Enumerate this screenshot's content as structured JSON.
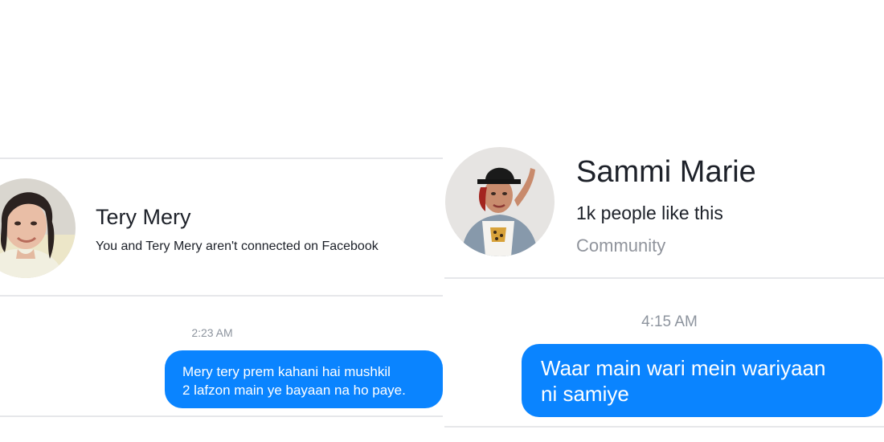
{
  "left_chat": {
    "contact_name": "Tery Mery",
    "connection_status": "You and Tery Mery aren't connected on Facebook",
    "timestamp": "2:23 AM",
    "message": {
      "line1": "Mery tery prem kahani hai mushkil",
      "line2": "2 lafzon main ye bayaan na ho paye."
    }
  },
  "right_chat": {
    "page_name": "Sammi Marie",
    "likes": "1k people like this",
    "category": "Community",
    "timestamp": "4:15 AM",
    "message": {
      "line1": "Waar main wari mein wariyaan",
      "line2": "ni samiye"
    }
  },
  "colors": {
    "bubble": "#0a84ff",
    "divider": "#e6e7ea",
    "timestamp": "#8d949e",
    "secondary_text": "#90949c"
  },
  "icons": {
    "left_avatar": "profile-photo",
    "right_avatar": "profile-photo"
  }
}
